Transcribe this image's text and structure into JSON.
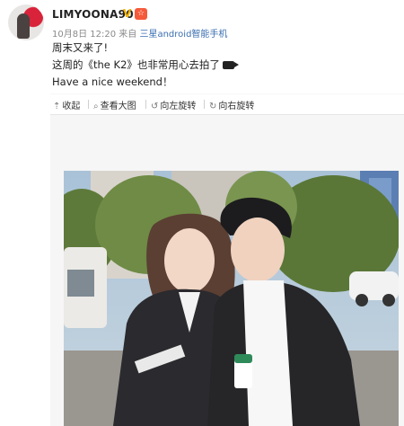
{
  "post": {
    "username": "LIMYOONA90",
    "verified_mark": "V",
    "vip_mark": "☆",
    "date": "10月8日 12:20",
    "source_prefix": "来自",
    "source": "三星android智能手机",
    "lines": [
      "周末又来了!",
      "这周的《the K2》也非常用心去拍了",
      "Have a nice weekend！"
    ]
  },
  "toolbar": {
    "collapse": "收起",
    "view_large": "查看大图",
    "rotate_left": "向左旋转",
    "rotate_right": "向右旋转"
  },
  "icons": {
    "collapse": "arrow-up-icon",
    "view_large": "magnifier-icon",
    "rotate_left": "rotate-left-icon",
    "rotate_right": "rotate-right-icon",
    "camera": "movie-camera-icon"
  },
  "colors": {
    "link": "#3b6fb1",
    "verified": "#f2b200",
    "vip": "#f55a3a"
  }
}
